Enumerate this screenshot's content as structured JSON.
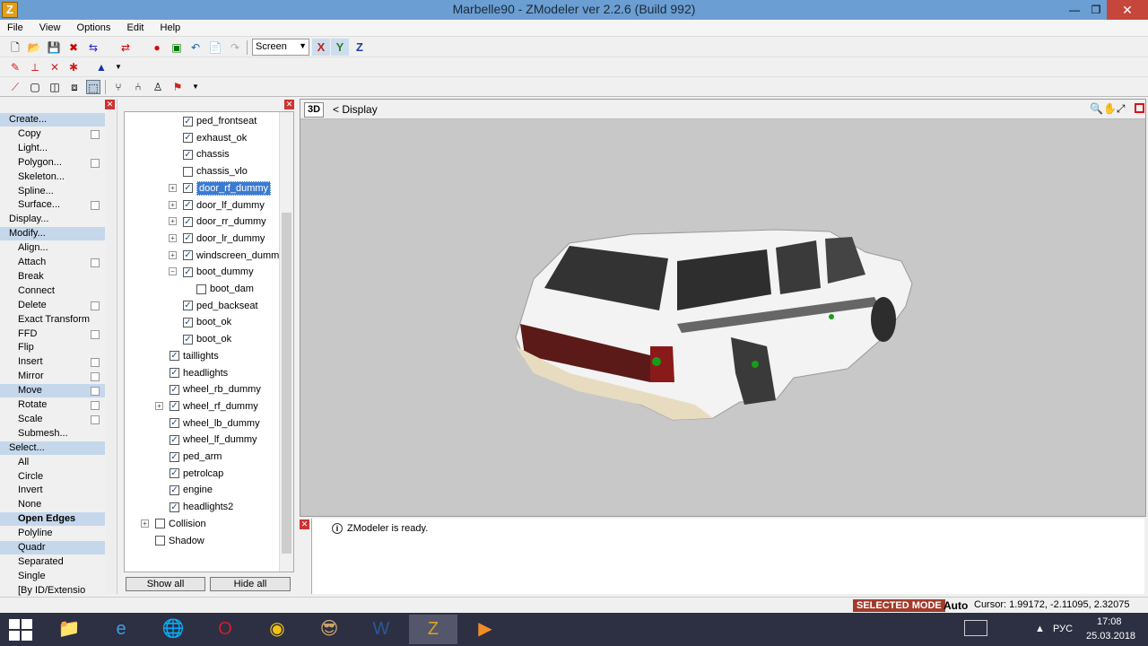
{
  "window": {
    "title": "Marbelle90 - ZModeler ver 2.2.6 (Build 992)",
    "app_icon": "Z",
    "minimize": "—",
    "maximize": "❐",
    "close": "✕"
  },
  "menu": [
    "File",
    "View",
    "Options",
    "Edit",
    "Help"
  ],
  "toolbar": {
    "screen_select": "Screen",
    "axes": [
      "X",
      "Y",
      "Z"
    ],
    "axis_colors": [
      "#c0201c",
      "#2d7d2d",
      "#1f3f9c"
    ]
  },
  "commands": [
    {
      "label": "Create...",
      "type": "header",
      "selected": true
    },
    {
      "label": "Copy",
      "box": true
    },
    {
      "label": "Light..."
    },
    {
      "label": "Polygon...",
      "box": true
    },
    {
      "label": "Skeleton..."
    },
    {
      "label": "Spline..."
    },
    {
      "label": "Surface...",
      "box": true
    },
    {
      "label": "Display...",
      "type": "header"
    },
    {
      "label": "Modify...",
      "type": "header",
      "selected": true
    },
    {
      "label": "Align..."
    },
    {
      "label": "Attach",
      "box": true
    },
    {
      "label": "Break"
    },
    {
      "label": "Connect"
    },
    {
      "label": "Delete",
      "box": true
    },
    {
      "label": "Exact Transform"
    },
    {
      "label": "FFD",
      "box": true
    },
    {
      "label": "Flip"
    },
    {
      "label": "Insert",
      "box": true
    },
    {
      "label": "Mirror",
      "box": true
    },
    {
      "label": "Move",
      "box": true,
      "selected": true
    },
    {
      "label": "Rotate",
      "box": true
    },
    {
      "label": "Scale",
      "box": true
    },
    {
      "label": "Submesh..."
    },
    {
      "label": "Select...",
      "type": "header",
      "selected": true
    },
    {
      "label": "All"
    },
    {
      "label": "Circle"
    },
    {
      "label": "Invert"
    },
    {
      "label": "None"
    },
    {
      "label": "Open Edges",
      "selected": true,
      "bold": true
    },
    {
      "label": "Polyline"
    },
    {
      "label": "Quadr",
      "selected": true
    },
    {
      "label": "Separated"
    },
    {
      "label": "Single"
    },
    {
      "label": "[By ID/Extensio"
    }
  ],
  "tree": [
    {
      "label": "ped_frontseat",
      "level": 2,
      "checked": true
    },
    {
      "label": "exhaust_ok",
      "level": 2,
      "checked": true
    },
    {
      "label": "chassis",
      "level": 2,
      "checked": true
    },
    {
      "label": "chassis_vlo",
      "level": 2,
      "checked": false
    },
    {
      "label": "door_rf_dummy",
      "level": 2,
      "checked": true,
      "expander": "+",
      "selected": true
    },
    {
      "label": "door_lf_dummy",
      "level": 2,
      "checked": true,
      "expander": "+"
    },
    {
      "label": "door_rr_dummy",
      "level": 2,
      "checked": true,
      "expander": "+"
    },
    {
      "label": "door_lr_dummy",
      "level": 2,
      "checked": true,
      "expander": "+"
    },
    {
      "label": "windscreen_dumm",
      "level": 2,
      "checked": true,
      "expander": "+"
    },
    {
      "label": "boot_dummy",
      "level": 2,
      "checked": true,
      "expander": "−"
    },
    {
      "label": "boot_dam",
      "level": 3,
      "checked": false
    },
    {
      "label": "ped_backseat",
      "level": 2,
      "checked": true
    },
    {
      "label": "boot_ok",
      "level": 2,
      "checked": true
    },
    {
      "label": "boot_ok",
      "level": 2,
      "checked": true
    },
    {
      "label": "taillights",
      "level": 1,
      "checked": true
    },
    {
      "label": "headlights",
      "level": 1,
      "checked": true
    },
    {
      "label": "wheel_rb_dummy",
      "level": 1,
      "checked": true
    },
    {
      "label": "wheel_rf_dummy",
      "level": 1,
      "checked": true,
      "expander": "+"
    },
    {
      "label": "wheel_lb_dummy",
      "level": 1,
      "checked": true
    },
    {
      "label": "wheel_lf_dummy",
      "level": 1,
      "checked": true
    },
    {
      "label": "ped_arm",
      "level": 1,
      "checked": true
    },
    {
      "label": "petrolcap",
      "level": 1,
      "checked": true
    },
    {
      "label": "engine",
      "level": 1,
      "checked": true
    },
    {
      "label": "headlights2",
      "level": 1,
      "checked": true
    },
    {
      "label": "Collision",
      "level": 0,
      "checked": false,
      "expander": "+"
    },
    {
      "label": "Shadow",
      "level": 0,
      "checked": false
    }
  ],
  "tree_buttons": {
    "show_all": "Show all",
    "hide_all": "Hide all"
  },
  "viewport": {
    "mode": "3D",
    "label": "< Display",
    "tools": "🔍✋⤢"
  },
  "console": {
    "message": "ZModeler is ready.",
    "info_glyph": "i"
  },
  "status": {
    "mode": "SELECTED MODE",
    "auto": "Auto",
    "cursor": "Cursor: 1.99172, -2.11095, 2.32075"
  },
  "taskbar": {
    "apps": [
      "📁",
      "e",
      "🌐",
      "O",
      "◉",
      "😎",
      "W",
      "Z",
      "▶"
    ],
    "active_index": 7,
    "tray_arrow": "▲",
    "lang": "РУС",
    "time": "17:08",
    "date": "25.03.2018"
  }
}
